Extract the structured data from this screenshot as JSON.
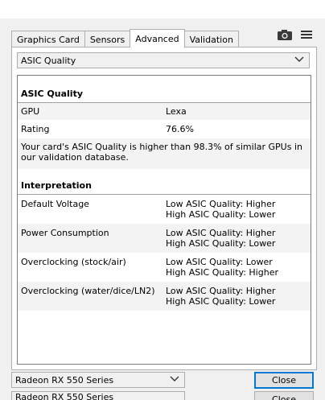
{
  "tabs": [
    {
      "label": "Graphics Card"
    },
    {
      "label": "Sensors"
    },
    {
      "label": "Advanced"
    },
    {
      "label": "Validation"
    }
  ],
  "active_tab": "Advanced",
  "section_select": {
    "value": "ASIC Quality"
  },
  "asic": {
    "title": "ASIC Quality",
    "rows": [
      {
        "key": "GPU",
        "value": "Lexa"
      },
      {
        "key": "Rating",
        "value": "76.6%"
      }
    ],
    "note": "Your card's ASIC Quality is higher than 98.3% of similar GPUs in our validation database."
  },
  "interpretation": {
    "title": "Interpretation",
    "rows": [
      {
        "key": "Default Voltage",
        "line1": "Low ASIC Quality: Higher",
        "line2": "High ASIC Quality: Lower"
      },
      {
        "key": "Power Consumption",
        "line1": "Low ASIC Quality: Higher",
        "line2": "High ASIC Quality: Lower"
      },
      {
        "key": "Overclocking (stock/air)",
        "line1": "Low ASIC Quality: Lower",
        "line2": "High ASIC Quality: Higher"
      },
      {
        "key": "Overclocking (water/dice/LN2)",
        "line1": "Low ASIC Quality: Higher",
        "line2": "High ASIC Quality: Lower"
      }
    ]
  },
  "footer": {
    "gpu_select": "Radeon RX 550 Series",
    "close_label": "Close"
  },
  "colors": {
    "accent": "#0078d7",
    "panel_bg": "#ffffff",
    "window_bg": "#f0f0f0"
  },
  "icons": [
    "camera-icon",
    "hamburger-menu-icon",
    "chevron-down-icon"
  ]
}
